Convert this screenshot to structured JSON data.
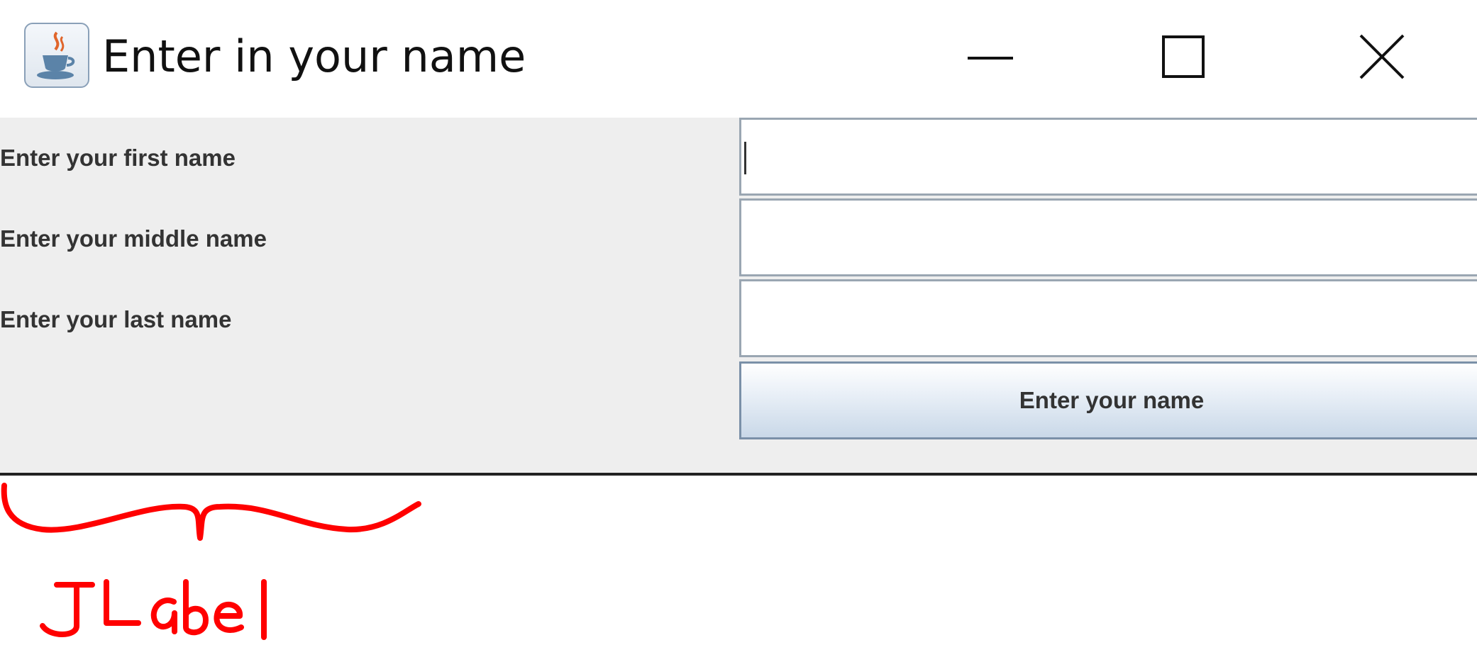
{
  "window": {
    "title": "Enter in your name",
    "icon": "java-coffee-cup-icon",
    "controls": [
      "minimize-icon",
      "maximize-icon",
      "close-icon"
    ]
  },
  "form": {
    "labels": {
      "first": "Enter your first name",
      "middle": "Enter your middle name",
      "last": "Enter your last name"
    },
    "fields": {
      "first": {
        "value": "",
        "focused": true
      },
      "middle": {
        "value": ""
      },
      "last": {
        "value": ""
      }
    },
    "button": {
      "label": "Enter your name"
    }
  },
  "annotation": {
    "text": "JLabel",
    "color": "#ff0000"
  },
  "colors": {
    "panel_background": "#eeeeee",
    "label_text": "#333333",
    "field_border": "#9aa6b2",
    "button_gradient_bottom": "#c9d8e8"
  }
}
